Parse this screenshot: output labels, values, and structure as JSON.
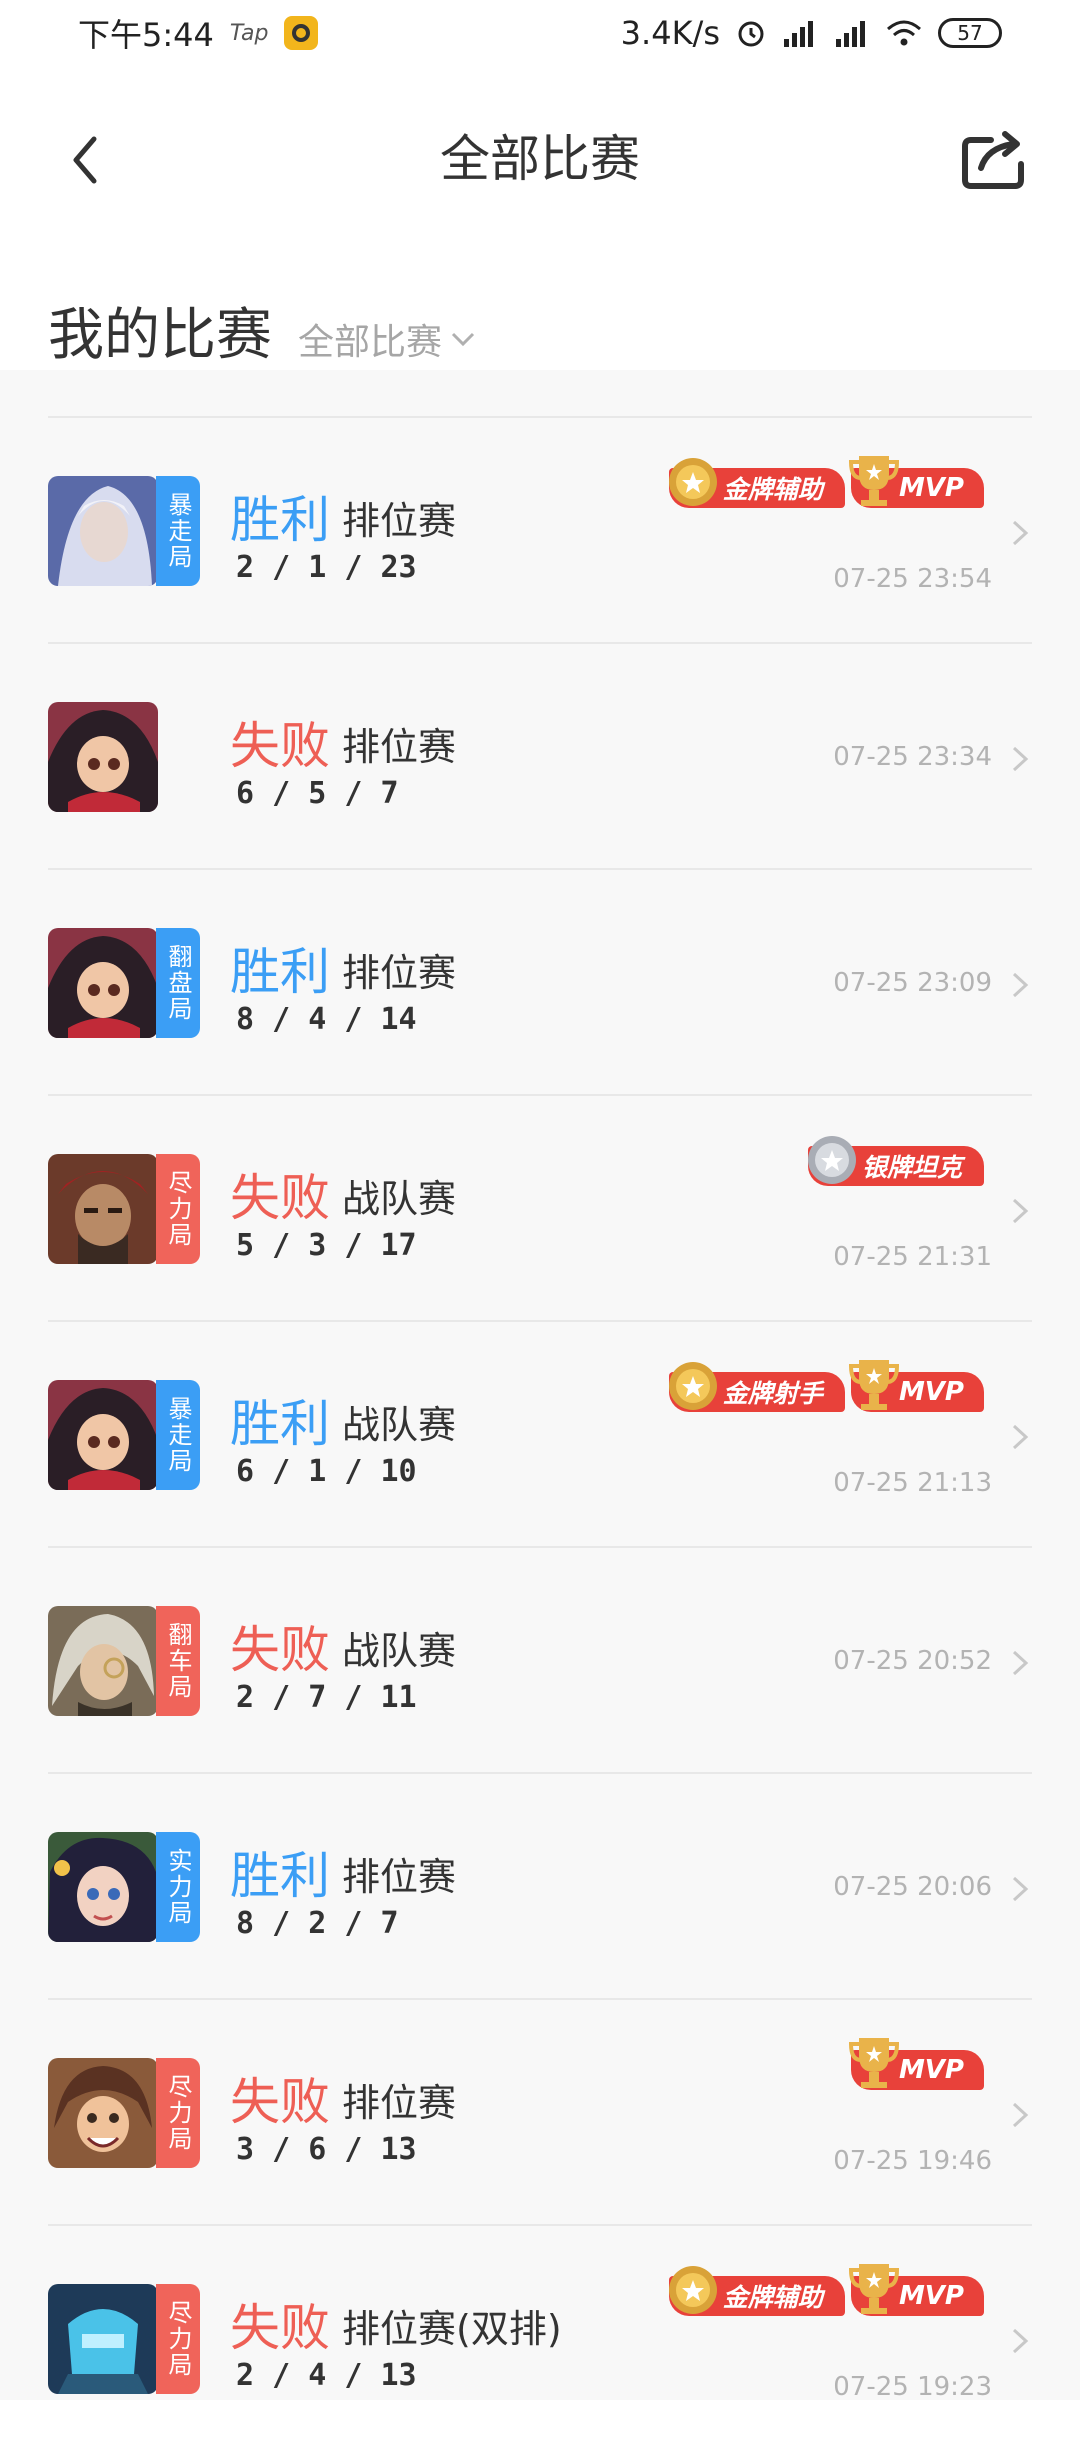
{
  "status": {
    "time": "下午5:44",
    "tap": "Tap",
    "speed": "3.4K/s",
    "battery": "57"
  },
  "header": {
    "title": "全部比赛"
  },
  "section": {
    "title": "我的比赛",
    "filter": "全部比赛"
  },
  "matches": [
    {
      "tag": "暴走局",
      "tag_color": "#3b9ef5",
      "result": "胜利",
      "mode": "排位赛",
      "kda": "2 / 1 / 23",
      "time": "07-25 23:54",
      "badge": "金牌辅助",
      "mvp": "MVP"
    },
    {
      "tag": "",
      "tag_color": "",
      "result": "失败",
      "mode": "排位赛",
      "kda": "6 / 5 / 7",
      "time": "07-25 23:34",
      "badge": "",
      "mvp": ""
    },
    {
      "tag": "翻盘局",
      "tag_color": "#3b9ef5",
      "result": "胜利",
      "mode": "排位赛",
      "kda": "8 / 4 / 14",
      "time": "07-25 23:09",
      "badge": "",
      "mvp": ""
    },
    {
      "tag": "尽力局",
      "tag_color": "#f0645a",
      "result": "失败",
      "mode": "战队赛",
      "kda": "5 / 3 / 17",
      "time": "07-25 21:31",
      "badge": "银牌坦克",
      "mvp": ""
    },
    {
      "tag": "暴走局",
      "tag_color": "#3b9ef5",
      "result": "胜利",
      "mode": "战队赛",
      "kda": "6 / 1 / 10",
      "time": "07-25 21:13",
      "badge": "金牌射手",
      "mvp": "MVP"
    },
    {
      "tag": "翻车局",
      "tag_color": "#f0645a",
      "result": "失败",
      "mode": "战队赛",
      "kda": "2 / 7 / 11",
      "time": "07-25 20:52",
      "badge": "",
      "mvp": ""
    },
    {
      "tag": "实力局",
      "tag_color": "#3b9ef5",
      "result": "胜利",
      "mode": "排位赛",
      "kda": "8 / 2 / 7",
      "time": "07-25 20:06",
      "badge": "",
      "mvp": ""
    },
    {
      "tag": "尽力局",
      "tag_color": "#f0645a",
      "result": "失败",
      "mode": "排位赛",
      "kda": "3 / 6 / 13",
      "time": "07-25 19:46",
      "badge": "",
      "mvp": "MVP"
    },
    {
      "tag": "尽力局",
      "tag_color": "#f0645a",
      "result": "失败",
      "mode": "排位赛(双排)",
      "kda": "2 / 4 / 13",
      "time": "07-25 19:23",
      "badge": "金牌辅助",
      "mvp": "MVP"
    }
  ],
  "colors": {
    "win": "#3b9ef5",
    "lose": "#ee5f55",
    "badge": "#e8413a"
  }
}
